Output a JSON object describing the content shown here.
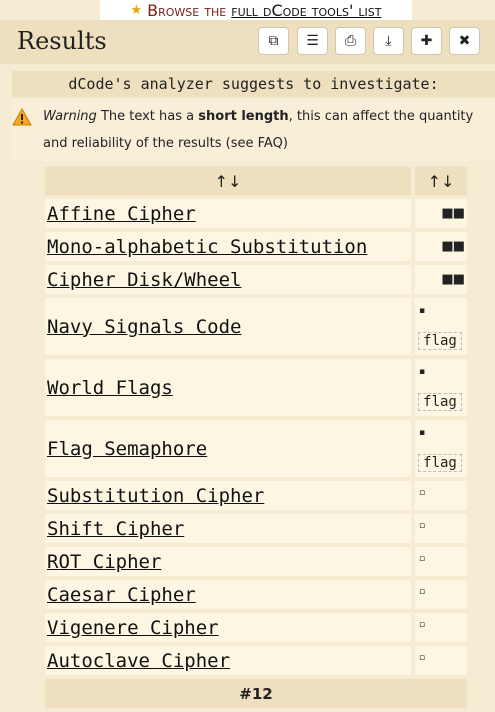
{
  "topbar": {
    "label_a": "Browse the",
    "label_b": "full dCode tools' list"
  },
  "header": {
    "title": "Results"
  },
  "toolbar": [
    {
      "name": "copy-icon",
      "glyph": "⧉"
    },
    {
      "name": "scroll-icon",
      "glyph": "☰"
    },
    {
      "name": "print-icon",
      "glyph": "⎙"
    },
    {
      "name": "download-icon",
      "glyph": "⤓"
    },
    {
      "name": "pin-icon",
      "glyph": "✚"
    },
    {
      "name": "close-icon",
      "glyph": "✖"
    }
  ],
  "suggest": {
    "text": "dCode's analyzer suggests to investigate:"
  },
  "warning": {
    "label": "Warning",
    "pre": "The text has a",
    "bold": "short length",
    "post": ", this can affect the quantity and reliability of the results (see FAQ)"
  },
  "table": {
    "sort_symbol": "↑↓",
    "rows": [
      {
        "name": "Affine Cipher",
        "score": "■■"
      },
      {
        "name": "Mono-alphabetic Substitution",
        "score": "■■"
      },
      {
        "name": "Cipher Disk/Wheel",
        "score": "■■"
      },
      {
        "name": "Navy Signals Code",
        "score": "▪",
        "tag": "flag"
      },
      {
        "name": "World Flags",
        "score": "▪",
        "tag": "flag"
      },
      {
        "name": "Flag Semaphore",
        "score": "▪",
        "tag": "flag"
      },
      {
        "name": "Substitution Cipher",
        "score": "▫"
      },
      {
        "name": "Shift Cipher",
        "score": "▫"
      },
      {
        "name": "ROT Cipher",
        "score": "▫"
      },
      {
        "name": "Caesar Cipher",
        "score": "▫"
      },
      {
        "name": "Vigenere Cipher",
        "score": "▫"
      },
      {
        "name": "Autoclave Cipher",
        "score": "▫"
      }
    ],
    "footer": "#12"
  }
}
